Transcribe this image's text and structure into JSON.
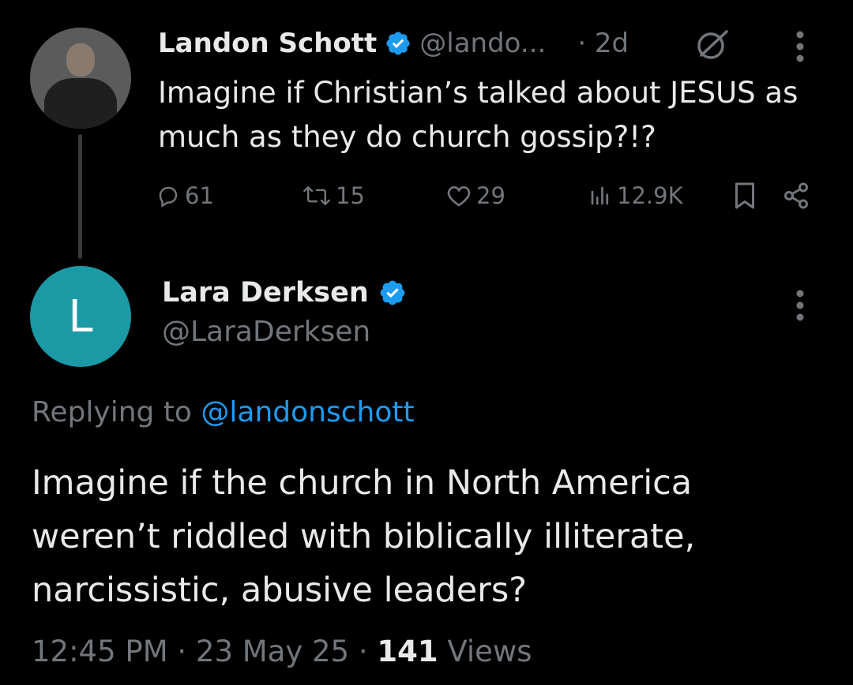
{
  "parent_tweet": {
    "author_name": "Landon Schott",
    "handle": "@lando...",
    "time": "· 2d",
    "text": "Imagine if Christian’s talked about JESUS as much as they do church gossip?!?",
    "stats": {
      "replies": "61",
      "retweets": "15",
      "likes": "29",
      "views": "12.9K"
    }
  },
  "reply_tweet": {
    "avatar_letter": "L",
    "author_name": "Lara Derksen",
    "handle": "@LaraDerksen",
    "replying_prefix": "Replying to ",
    "replying_to": "@landonschott",
    "text": "Imagine if the church in North America weren’t riddled with biblically illiterate, narcissistic, abusive leaders?",
    "time": "12:45 PM",
    "date": "23 May 25",
    "views_count": "141",
    "views_label": "Views"
  },
  "colors": {
    "background": "#000000",
    "text": "#e7e9ea",
    "muted": "#71767b",
    "accent": "#1d9bf0",
    "verified": "#1d9bf0",
    "avatar_reply": "#1b9aa6"
  },
  "icons": [
    "verified-badge-icon",
    "grok-icon",
    "more-icon",
    "reply-icon",
    "retweet-icon",
    "like-icon",
    "views-icon",
    "bookmark-icon",
    "share-icon"
  ]
}
